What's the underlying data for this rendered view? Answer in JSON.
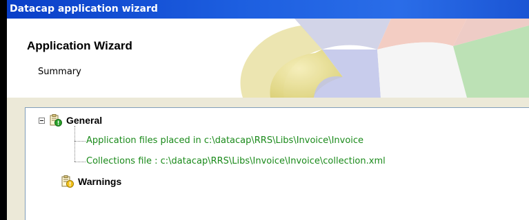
{
  "window": {
    "title": "Datacap application wizard"
  },
  "header": {
    "title": "Application Wizard",
    "subtitle": "Summary"
  },
  "tree": {
    "general": {
      "label": "General",
      "icon": "report-check-icon",
      "children": [
        "Application files placed in c:\\datacap\\RRS\\Libs\\Invoice\\Invoice",
        "Collections file : c:\\datacap\\RRS\\Libs\\Invoice\\Invoice\\collection.xml"
      ]
    },
    "warnings": {
      "label": "Warnings",
      "icon": "report-warning-icon"
    }
  },
  "colors": {
    "titlebar": "#0a3fc8",
    "child_text": "#1a8a1a"
  }
}
